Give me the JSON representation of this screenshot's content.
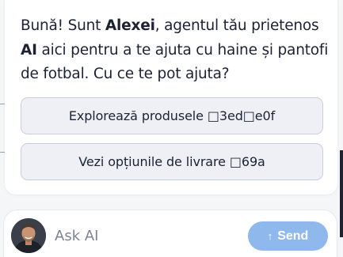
{
  "chat": {
    "greeting_prefix": "Bună! Sunt ",
    "agent_name": "Alexei",
    "greeting_mid": ", agentul tău prietenos ",
    "ai_label": "AI",
    "greeting_suffix": " aici pentru a te ajuta cu haine și pantofi de fotbal. Cu ce te pot ajuta?",
    "options": [
      {
        "label": "Explorează produsele □3ed□e0f"
      },
      {
        "label": "Vezi opțiunile de livrare □69a"
      }
    ]
  },
  "composer": {
    "avatar_icon": "user-avatar",
    "placeholder": "Ask AI",
    "send_label": "Send",
    "send_icon": "arrow-up-icon",
    "send_color": "#8fb8ec"
  }
}
